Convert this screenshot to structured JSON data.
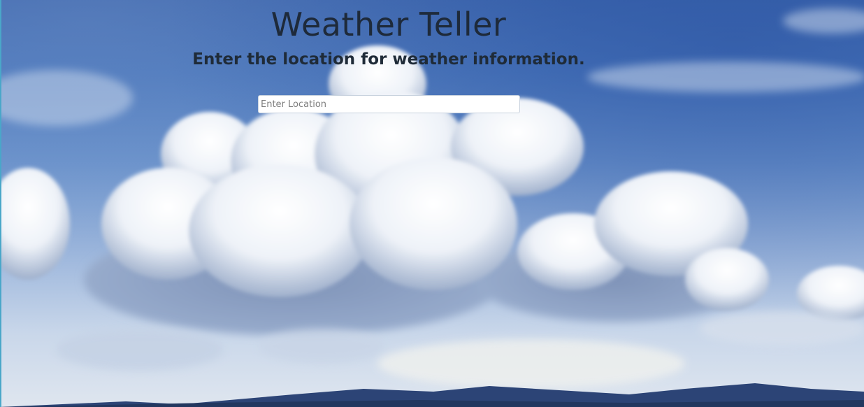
{
  "app": {
    "title": "Weather Teller",
    "subtitle": "Enter the location for weather information."
  },
  "search": {
    "placeholder": "Enter Location",
    "value": ""
  },
  "background": {
    "image": "sky-with-clouds",
    "colors": {
      "sky_top": "#3f69b0",
      "sky_bottom": "#dfe6ef",
      "title_text": "#1e2a3a"
    }
  }
}
